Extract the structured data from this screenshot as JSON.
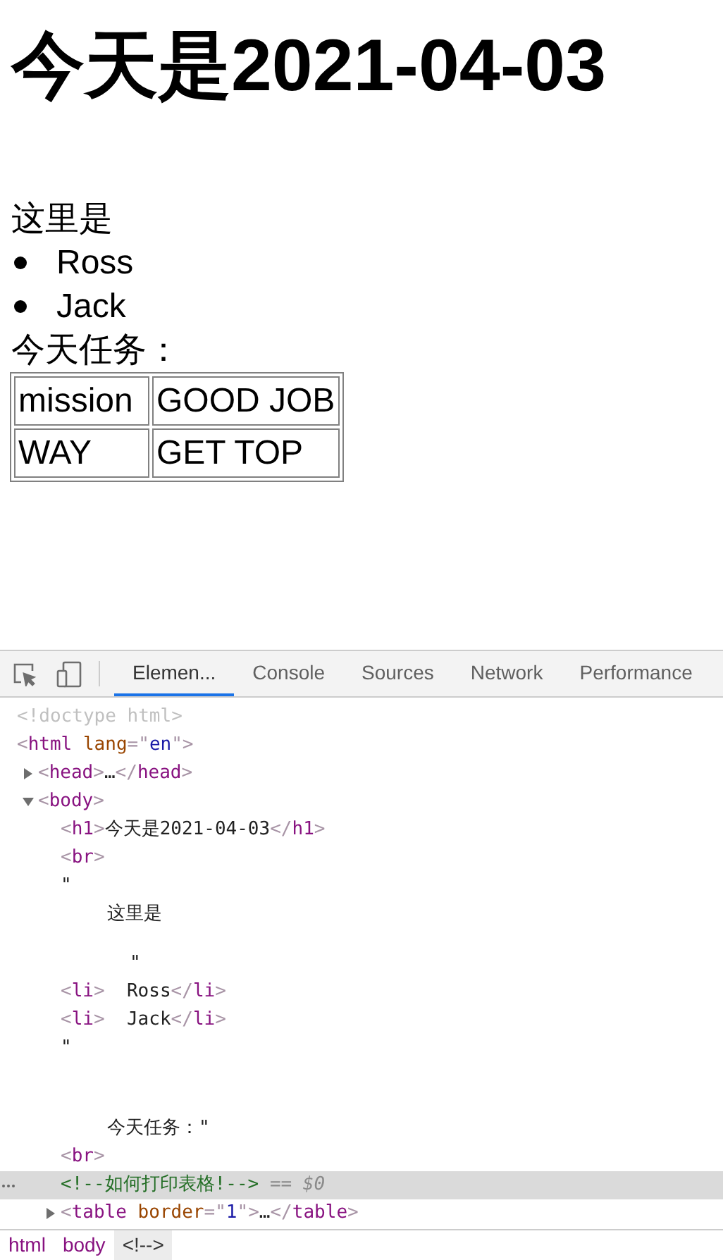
{
  "page": {
    "heading": "今天是2021-04-03",
    "intro": "这里是",
    "list_items": [
      "Ross",
      "Jack"
    ],
    "task_label": "今天任务：",
    "table": {
      "rows": [
        [
          "mission",
          "GOOD JOB"
        ],
        [
          "WAY",
          "GET TOP"
        ]
      ]
    }
  },
  "devtools": {
    "tabs": [
      {
        "label": "Elemen...",
        "selected": true
      },
      {
        "label": "Console",
        "selected": false
      },
      {
        "label": "Sources",
        "selected": false
      },
      {
        "label": "Network",
        "selected": false
      },
      {
        "label": "Performance",
        "selected": false
      }
    ],
    "dom_tree": [
      {
        "kind": "node",
        "selected": false,
        "segments": [
          {
            "kind": "doctype",
            "text": "<!doctype html>"
          }
        ]
      },
      {
        "kind": "node",
        "selected": false,
        "segments": [
          {
            "kind": "punct",
            "text": "<"
          },
          {
            "kind": "tag",
            "text": "html"
          },
          {
            "kind": "attr",
            "text": " lang"
          },
          {
            "kind": "punct",
            "text": "=\""
          },
          {
            "kind": "value",
            "text": "en"
          },
          {
            "kind": "punct",
            "text": "\">"
          }
        ],
        "children": [
          {
            "kind": "node",
            "selected": false,
            "expanded": false,
            "segments": [
              {
                "kind": "punct",
                "text": "<"
              },
              {
                "kind": "tag",
                "text": "head"
              },
              {
                "kind": "punct",
                "text": ">"
              },
              {
                "kind": "text",
                "text": "…"
              },
              {
                "kind": "punct",
                "text": "</"
              },
              {
                "kind": "tag",
                "text": "head"
              },
              {
                "kind": "punct",
                "text": ">"
              }
            ]
          },
          {
            "kind": "node",
            "selected": false,
            "expanded": true,
            "segments": [
              {
                "kind": "punct",
                "text": "<"
              },
              {
                "kind": "tag",
                "text": "body"
              },
              {
                "kind": "punct",
                "text": ">"
              }
            ],
            "children": [
              {
                "kind": "node",
                "selected": false,
                "segments": [
                  {
                    "kind": "punct",
                    "text": "<"
                  },
                  {
                    "kind": "tag",
                    "text": "h1"
                  },
                  {
                    "kind": "punct",
                    "text": ">"
                  },
                  {
                    "kind": "text",
                    "text": "今天是2021-04-03"
                  },
                  {
                    "kind": "punct",
                    "text": "</"
                  },
                  {
                    "kind": "tag",
                    "text": "h1"
                  },
                  {
                    "kind": "punct",
                    "text": ">"
                  }
                ]
              },
              {
                "kind": "node",
                "selected": false,
                "segments": [
                  {
                    "kind": "punct",
                    "text": "<"
                  },
                  {
                    "kind": "tag",
                    "text": "br"
                  },
                  {
                    "kind": "punct",
                    "text": ">"
                  }
                ]
              },
              {
                "kind": "quote",
                "selected": false,
                "segments": [
                  {
                    "kind": "text",
                    "text": "\""
                  }
                ]
              },
              {
                "kind": "text",
                "selected": false,
                "segments": [
                  {
                    "kind": "text",
                    "text": "这里是"
                  }
                ]
              },
              {
                "kind": "text_end",
                "selected": false,
                "segments": [
                  {
                    "kind": "text",
                    "text": "\""
                  }
                ]
              },
              {
                "kind": "node",
                "selected": false,
                "segments": [
                  {
                    "kind": "punct",
                    "text": "<"
                  },
                  {
                    "kind": "tag",
                    "text": "li"
                  },
                  {
                    "kind": "punct",
                    "text": ">"
                  },
                  {
                    "kind": "text",
                    "text": "  Ross"
                  },
                  {
                    "kind": "punct",
                    "text": "</"
                  },
                  {
                    "kind": "tag",
                    "text": "li"
                  },
                  {
                    "kind": "punct",
                    "text": ">"
                  }
                ]
              },
              {
                "kind": "node",
                "selected": false,
                "segments": [
                  {
                    "kind": "punct",
                    "text": "<"
                  },
                  {
                    "kind": "tag",
                    "text": "li"
                  },
                  {
                    "kind": "punct",
                    "text": ">"
                  },
                  {
                    "kind": "text",
                    "text": "  Jack"
                  },
                  {
                    "kind": "punct",
                    "text": "</"
                  },
                  {
                    "kind": "tag",
                    "text": "li"
                  },
                  {
                    "kind": "punct",
                    "text": ">"
                  }
                ]
              },
              {
                "kind": "quote",
                "selected": false,
                "segments": [
                  {
                    "kind": "text",
                    "text": "\""
                  }
                ]
              },
              {
                "kind": "text_after_blank",
                "selected": false,
                "segments": [
                  {
                    "kind": "text",
                    "text": "今天任务：\""
                  }
                ]
              },
              {
                "kind": "node",
                "selected": false,
                "segments": [
                  {
                    "kind": "punct",
                    "text": "<"
                  },
                  {
                    "kind": "tag",
                    "text": "br"
                  },
                  {
                    "kind": "punct",
                    "text": ">"
                  }
                ]
              },
              {
                "kind": "node",
                "selected": true,
                "segments": [
                  {
                    "kind": "comment",
                    "text": "<!--如何打印表格!-->"
                  },
                  {
                    "kind": "ref",
                    "text": " == $0"
                  }
                ]
              },
              {
                "kind": "node",
                "selected": false,
                "expanded": false,
                "segments": [
                  {
                    "kind": "punct",
                    "text": "<"
                  },
                  {
                    "kind": "tag",
                    "text": "table"
                  },
                  {
                    "kind": "attr",
                    "text": " border"
                  },
                  {
                    "kind": "punct",
                    "text": "=\""
                  },
                  {
                    "kind": "value",
                    "text": "1"
                  },
                  {
                    "kind": "punct",
                    "text": "\">"
                  },
                  {
                    "kind": "text",
                    "text": "…"
                  },
                  {
                    "kind": "punct",
                    "text": "</"
                  },
                  {
                    "kind": "tag",
                    "text": "table"
                  },
                  {
                    "kind": "punct",
                    "text": ">"
                  }
                ]
              }
            ]
          }
        ]
      }
    ],
    "breadcrumbs": [
      {
        "label": "html",
        "selected": false
      },
      {
        "label": "body",
        "selected": false
      },
      {
        "label": "<!-->",
        "selected": true
      }
    ]
  }
}
